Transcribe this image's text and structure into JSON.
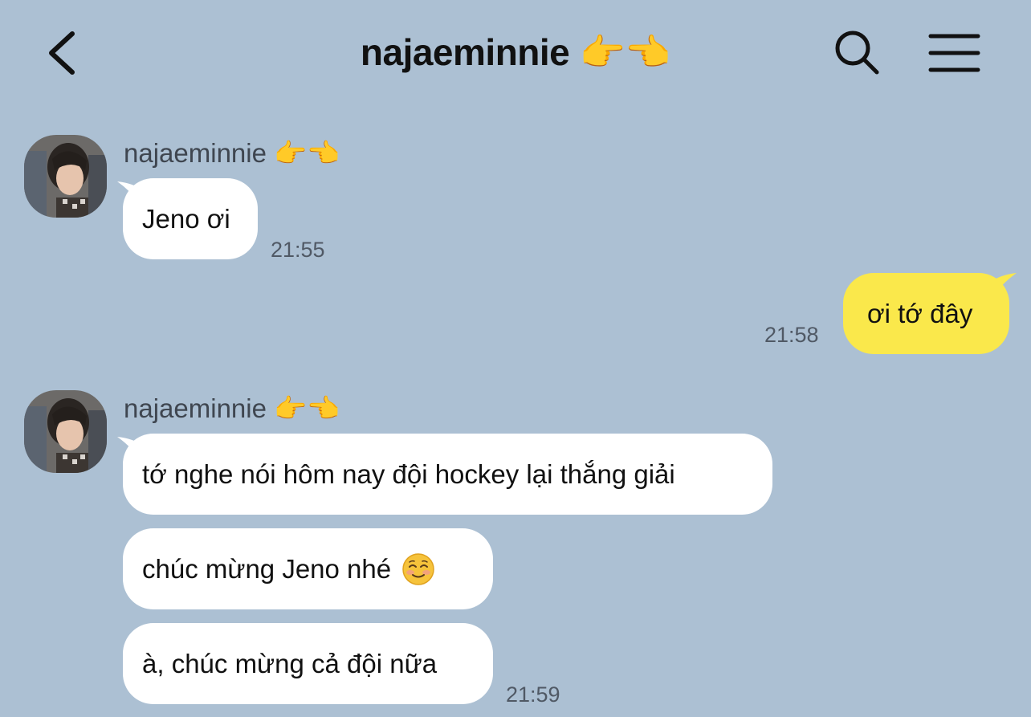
{
  "header": {
    "title": "najaeminnie 👉👈",
    "back_icon": "chevron-left-icon",
    "search_icon": "search-icon",
    "menu_icon": "hamburger-menu-icon"
  },
  "messages": [
    {
      "sender": "najaeminnie 👉👈",
      "text": "Jeno ơi",
      "time": "21:55"
    },
    {
      "sender": "me",
      "text": "ơi tớ đây",
      "time": "21:58"
    },
    {
      "sender": "najaeminnie 👉👈",
      "lines": [
        "tớ nghe nói hôm nay đội hockey lại thắng giải",
        "chúc mừng Jeno nhé",
        "à, chúc mừng cả đội nữa"
      ],
      "emoji": "smiling-face-icon",
      "time": "21:59"
    }
  ],
  "colors": {
    "background": "#acc0d3",
    "incoming_bubble": "#ffffff",
    "outgoing_bubble": "#fae84b"
  }
}
